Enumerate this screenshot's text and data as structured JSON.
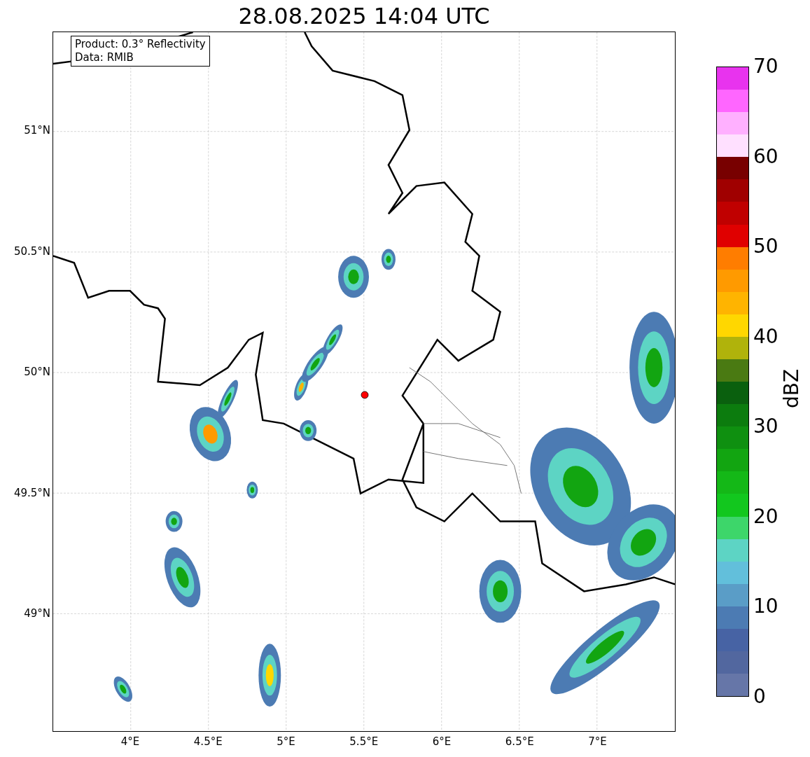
{
  "title": "28.08.2025 14:04 UTC",
  "info_box": [
    "Product: 0.3° Reflectivity",
    "Data: RMIB"
  ],
  "y_ticks": [
    "51°N",
    "50.5°N",
    "50°N",
    "49.5°N",
    "49°N"
  ],
  "x_ticks": [
    "4°E",
    "4.5°E",
    "5°E",
    "5.5°E",
    "6°E",
    "6.5°E",
    "7°E"
  ],
  "colorbar": {
    "label": "dBZ",
    "ticks": [
      "70",
      "60",
      "50",
      "40",
      "30",
      "20",
      "10",
      "0"
    ],
    "segments": [
      {
        "color": "#e833ee"
      },
      {
        "color": "#ff66ff"
      },
      {
        "color": "#ffb0ff"
      },
      {
        "color": "#ffe0ff"
      },
      {
        "color": "#780000"
      },
      {
        "color": "#a00000"
      },
      {
        "color": "#c00000"
      },
      {
        "color": "#e00000"
      },
      {
        "color": "#ff7d00"
      },
      {
        "color": "#ff9a00"
      },
      {
        "color": "#ffb400"
      },
      {
        "color": "#ffd700"
      },
      {
        "color": "#b0b30b"
      },
      {
        "color": "#4a7a12"
      },
      {
        "color": "#0a600e"
      },
      {
        "color": "#0c7c0e"
      },
      {
        "color": "#0f9010"
      },
      {
        "color": "#12a511"
      },
      {
        "color": "#14b817"
      },
      {
        "color": "#12c71e"
      },
      {
        "color": "#3dd66a"
      },
      {
        "color": "#5dd4c4"
      },
      {
        "color": "#62bfdb"
      },
      {
        "color": "#5a9dc7"
      },
      {
        "color": "#4c7bb3"
      },
      {
        "color": "#4763a4"
      },
      {
        "color": "#52679f"
      },
      {
        "color": "#6676a8"
      }
    ]
  }
}
